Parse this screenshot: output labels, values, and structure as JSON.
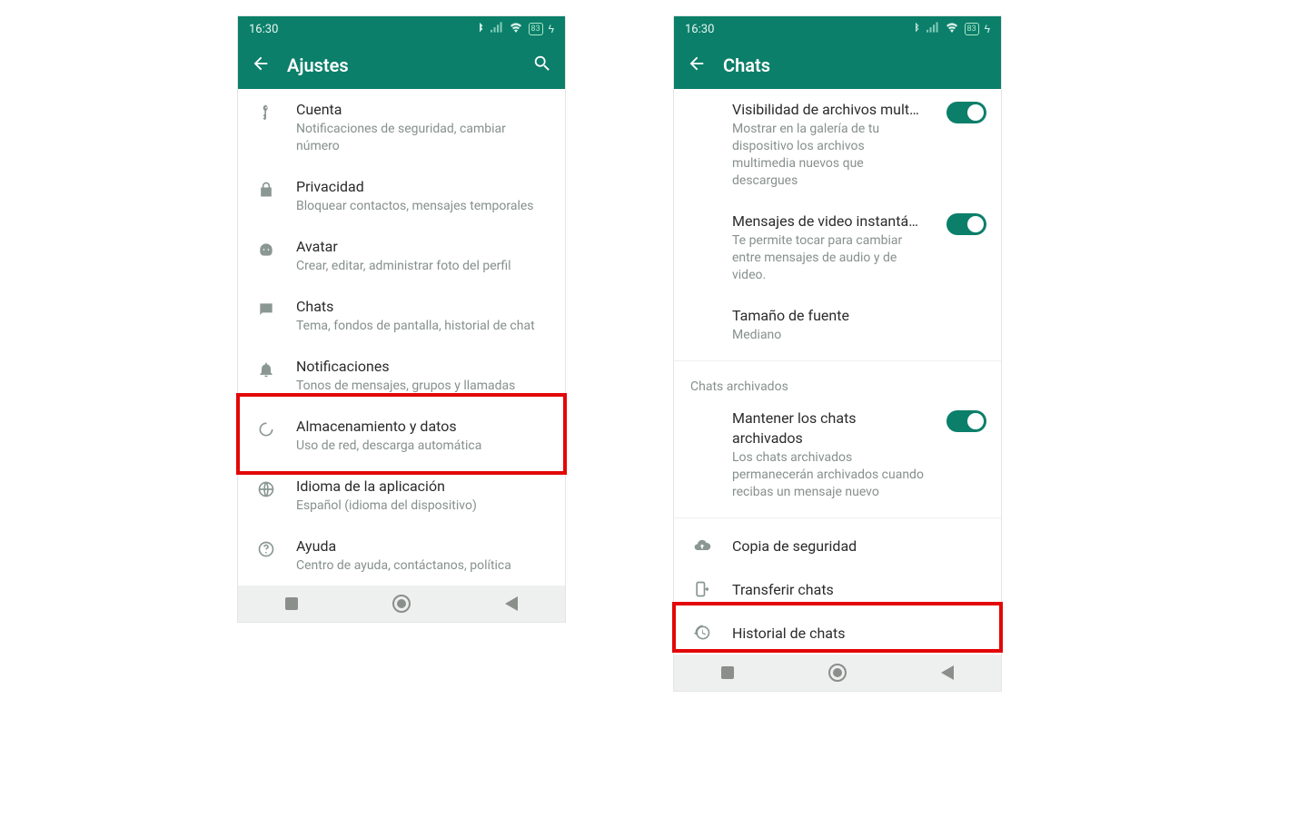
{
  "status": {
    "time": "16:30",
    "battery": "83"
  },
  "screen1": {
    "title": "Ajustes",
    "items": [
      {
        "title": "Cuenta",
        "sub": "Notificaciones de seguridad, cambiar número"
      },
      {
        "title": "Privacidad",
        "sub": "Bloquear contactos, mensajes temporales"
      },
      {
        "title": "Avatar",
        "sub": "Crear, editar, administrar foto del perfil"
      },
      {
        "title": "Chats",
        "sub": "Tema, fondos de pantalla, historial de chat"
      },
      {
        "title": "Notificaciones",
        "sub": "Tonos de mensajes, grupos y llamadas"
      },
      {
        "title": "Almacenamiento y datos",
        "sub": "Uso de red, descarga automática"
      },
      {
        "title": "Idioma de la aplicación",
        "sub": "Español (idioma del dispositivo)"
      },
      {
        "title": "Ayuda",
        "sub": "Centro de ayuda, contáctanos, política"
      }
    ]
  },
  "screen2": {
    "title": "Chats",
    "media_vis": {
      "title": "Visibilidad de archivos mult…",
      "sub": "Mostrar en la galería de tu dispositivo los archivos multimedia nuevos que descargues"
    },
    "video_msg": {
      "title": "Mensajes de video instantá…",
      "sub": "Te permite tocar para cambiar entre mensajes de audio y de video."
    },
    "font_size": {
      "title": "Tamaño de fuente",
      "sub": "Mediano"
    },
    "section_archived": "Chats archivados",
    "keep_archived": {
      "title": "Mantener los chats archivados",
      "sub": "Los chats archivados permanecerán archivados cuando recibas un mensaje nuevo"
    },
    "backup": "Copia de seguridad",
    "transfer": "Transferir chats",
    "history": "Historial de chats"
  }
}
